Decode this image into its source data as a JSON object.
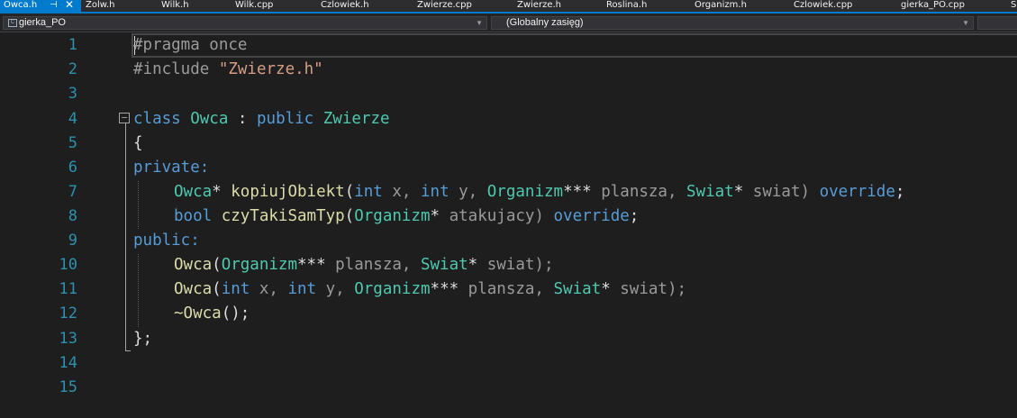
{
  "tabs": [
    {
      "label": "Owca.h",
      "active": true
    },
    {
      "label": "Zolw.h"
    },
    {
      "label": "Wilk.h"
    },
    {
      "label": "Wilk.cpp"
    },
    {
      "label": "Czlowiek.h"
    },
    {
      "label": "Zwierze.cpp"
    },
    {
      "label": "Zwierze.h"
    },
    {
      "label": "Roslina.h"
    },
    {
      "label": "Organizm.h"
    },
    {
      "label": "Czlowiek.cpp"
    },
    {
      "label": "gierka_PO.cpp"
    },
    {
      "label": "S"
    }
  ],
  "active_tab": {
    "pin_icon": "pin-icon",
    "close_icon": "close-icon"
  },
  "navbar": {
    "project": "gierka_PO",
    "scope": "(Globalny zasięg)"
  },
  "editor": {
    "line_numbers": [
      "1",
      "2",
      "3",
      "4",
      "5",
      "6",
      "7",
      "8",
      "9",
      "10",
      "11",
      "12",
      "13",
      "14",
      "15"
    ],
    "collapse_glyph": "−"
  },
  "code": {
    "l1": "#pragma once",
    "l2_directive": "#include ",
    "l2_file": "\"Zwierze.h\"",
    "l4_kw": "class",
    "l4_name": "Owca",
    "l4_colon": " : ",
    "l4_access": "public",
    "l4_base": "Zwierze",
    "l5": "{",
    "l6": "private:",
    "l7_type": "Owca",
    "l7_ptr": "*",
    "l7_fn": "kopiujObiekt",
    "l7_open": "(",
    "l7_int1": "int",
    "l7_x": " x, ",
    "l7_int2": "int",
    "l7_y": " y, ",
    "l7_org": "Organizm",
    "l7_stars": "***",
    "l7_plansza": " plansza, ",
    "l7_swiat": "Swiat",
    "l7_star2": "*",
    "l7_swiatp": " swiat) ",
    "l7_override": "override",
    "l7_semi": ";",
    "l8_bool": "bool",
    "l8_fn": "czyTakiSamTyp",
    "l8_open": "(",
    "l8_org": "Organizm",
    "l8_star": "*",
    "l8_param": " atakujacy) ",
    "l8_override": "override",
    "l8_semi": ";",
    "l9": "public:",
    "l10_fn": "Owca",
    "l10_open": "(",
    "l10_org": "Organizm",
    "l10_stars": "***",
    "l10_plansza": " plansza, ",
    "l10_swiat": "Swiat",
    "l10_star": "*",
    "l10_end": " swiat);",
    "l11_fn": "Owca",
    "l11_open": "(",
    "l11_int1": "int",
    "l11_x": " x, ",
    "l11_int2": "int",
    "l11_y": " y, ",
    "l11_org": "Organizm",
    "l11_stars": "***",
    "l11_plansza": " plansza, ",
    "l11_swiat": "Swiat",
    "l11_star": "*",
    "l11_end": " swiat);",
    "l12_fn": "~Owca",
    "l12_end": "();",
    "l13": "};"
  }
}
